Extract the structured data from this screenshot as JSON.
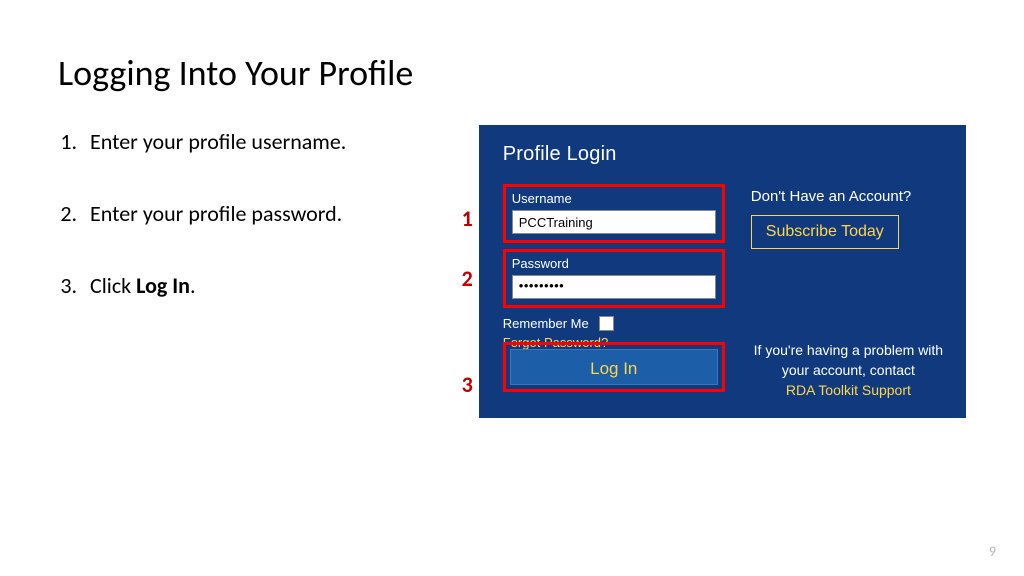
{
  "title": "Logging Into Your Profile",
  "steps": {
    "s1": "Enter your profile username.",
    "s2": "Enter your profile password.",
    "s3_prefix": "Click ",
    "s3_bold": "Log In",
    "s3_suffix": "."
  },
  "callouts": {
    "n1": "1",
    "n2": "2",
    "n3": "3"
  },
  "panel": {
    "header": "Profile Login",
    "username_label": "Username",
    "username_value": "PCCTraining",
    "password_label": "Password",
    "password_masked": "•••••••••",
    "remember_label": "Remember Me",
    "forgot_label": "Forgot Password?",
    "login_button": "Log In",
    "no_account": "Don't Have an Account?",
    "subscribe": "Subscribe Today",
    "problem": "If you're having a problem with your account, contact",
    "support": "RDA Toolkit Support"
  },
  "page_number": "9"
}
